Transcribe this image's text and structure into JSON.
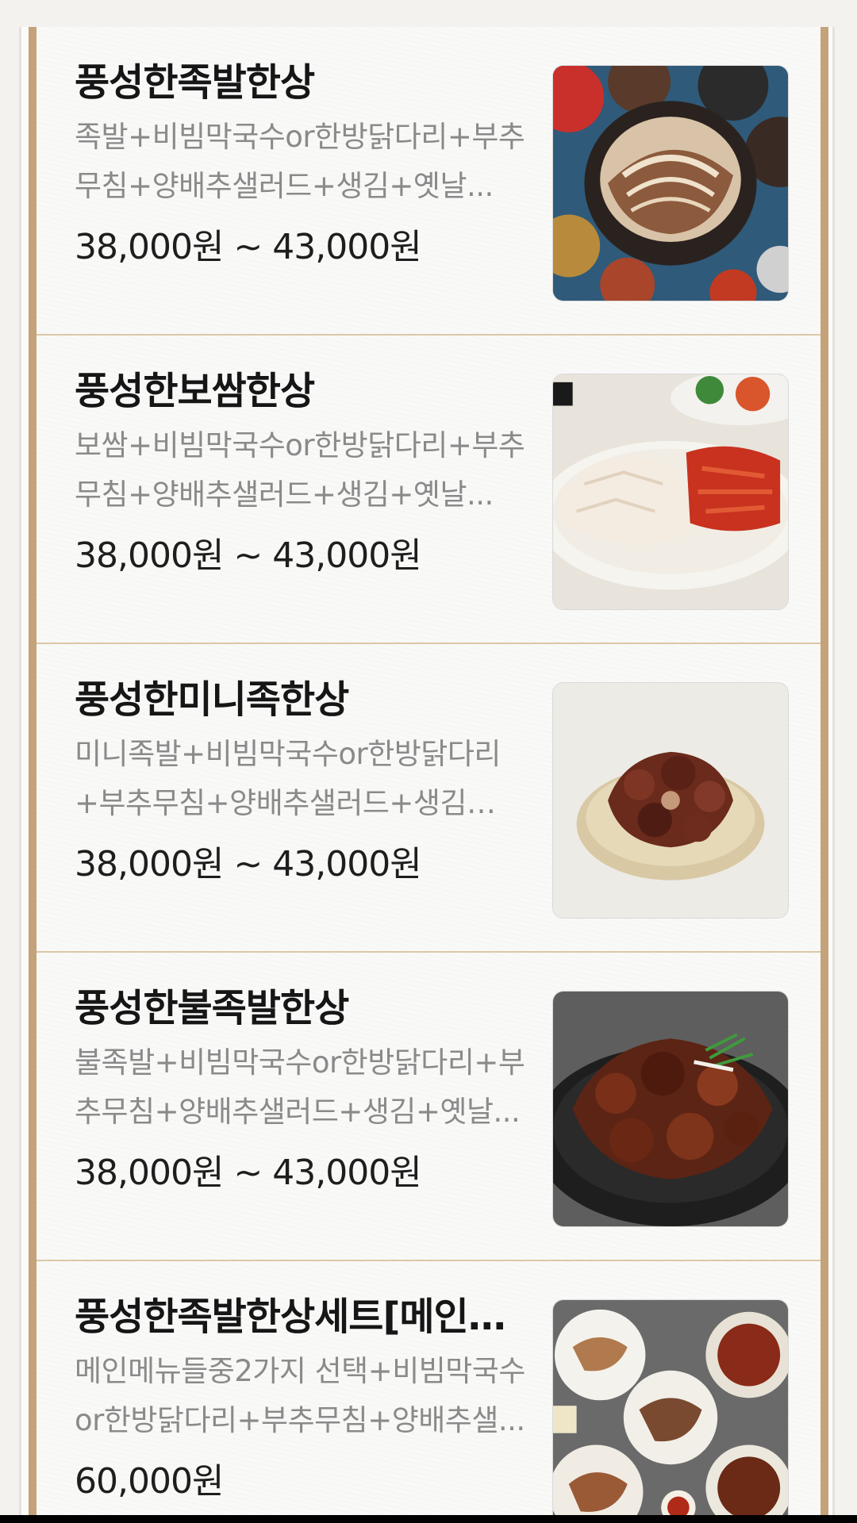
{
  "menu": {
    "items": [
      {
        "title": "풍성한족발한상",
        "description": "족발+비빔막국수or한방닭다리+부추무침+양배추샐러드+생김+옛날...",
        "price": "38,000원 ~ 43,000원",
        "image_icon": "jokbal-platter-photo"
      },
      {
        "title": "풍성한보쌈한상",
        "description": "보쌈+비빔막국수or한방닭다리+부추무침+양배추샐러드+생김+옛날...",
        "price": "38,000원 ~ 43,000원",
        "image_icon": "bossam-plate-photo"
      },
      {
        "title": "풍성한미니족한상",
        "description": "미니족발+비빔막국수or한방닭다리+부추무침+양배추샐러드+생김+옛...",
        "price": "38,000원 ~ 43,000원",
        "image_icon": "mini-jokbal-bowl-photo"
      },
      {
        "title": "풍성한불족발한상",
        "description": "불족발+비빔막국수or한방닭다리+부추무침+양배추샐러드+생김+옛날...",
        "price": "38,000원 ~ 43,000원",
        "image_icon": "spicy-jokbal-plate-photo"
      },
      {
        "title": "풍성한족발한상세트[메인메...",
        "description": "메인메뉴들중2가지 선택+비빔막국수or한방닭다리+부추무침+양배추샐...",
        "price": "60,000원",
        "image_icon": "jokbal-set-spread-photo"
      }
    ]
  },
  "colors": {
    "frame_gold": "#c4a27a",
    "divider": "#dcc7a6",
    "title": "#161616",
    "description": "#8a8a8a",
    "price": "#1e1e1e"
  }
}
